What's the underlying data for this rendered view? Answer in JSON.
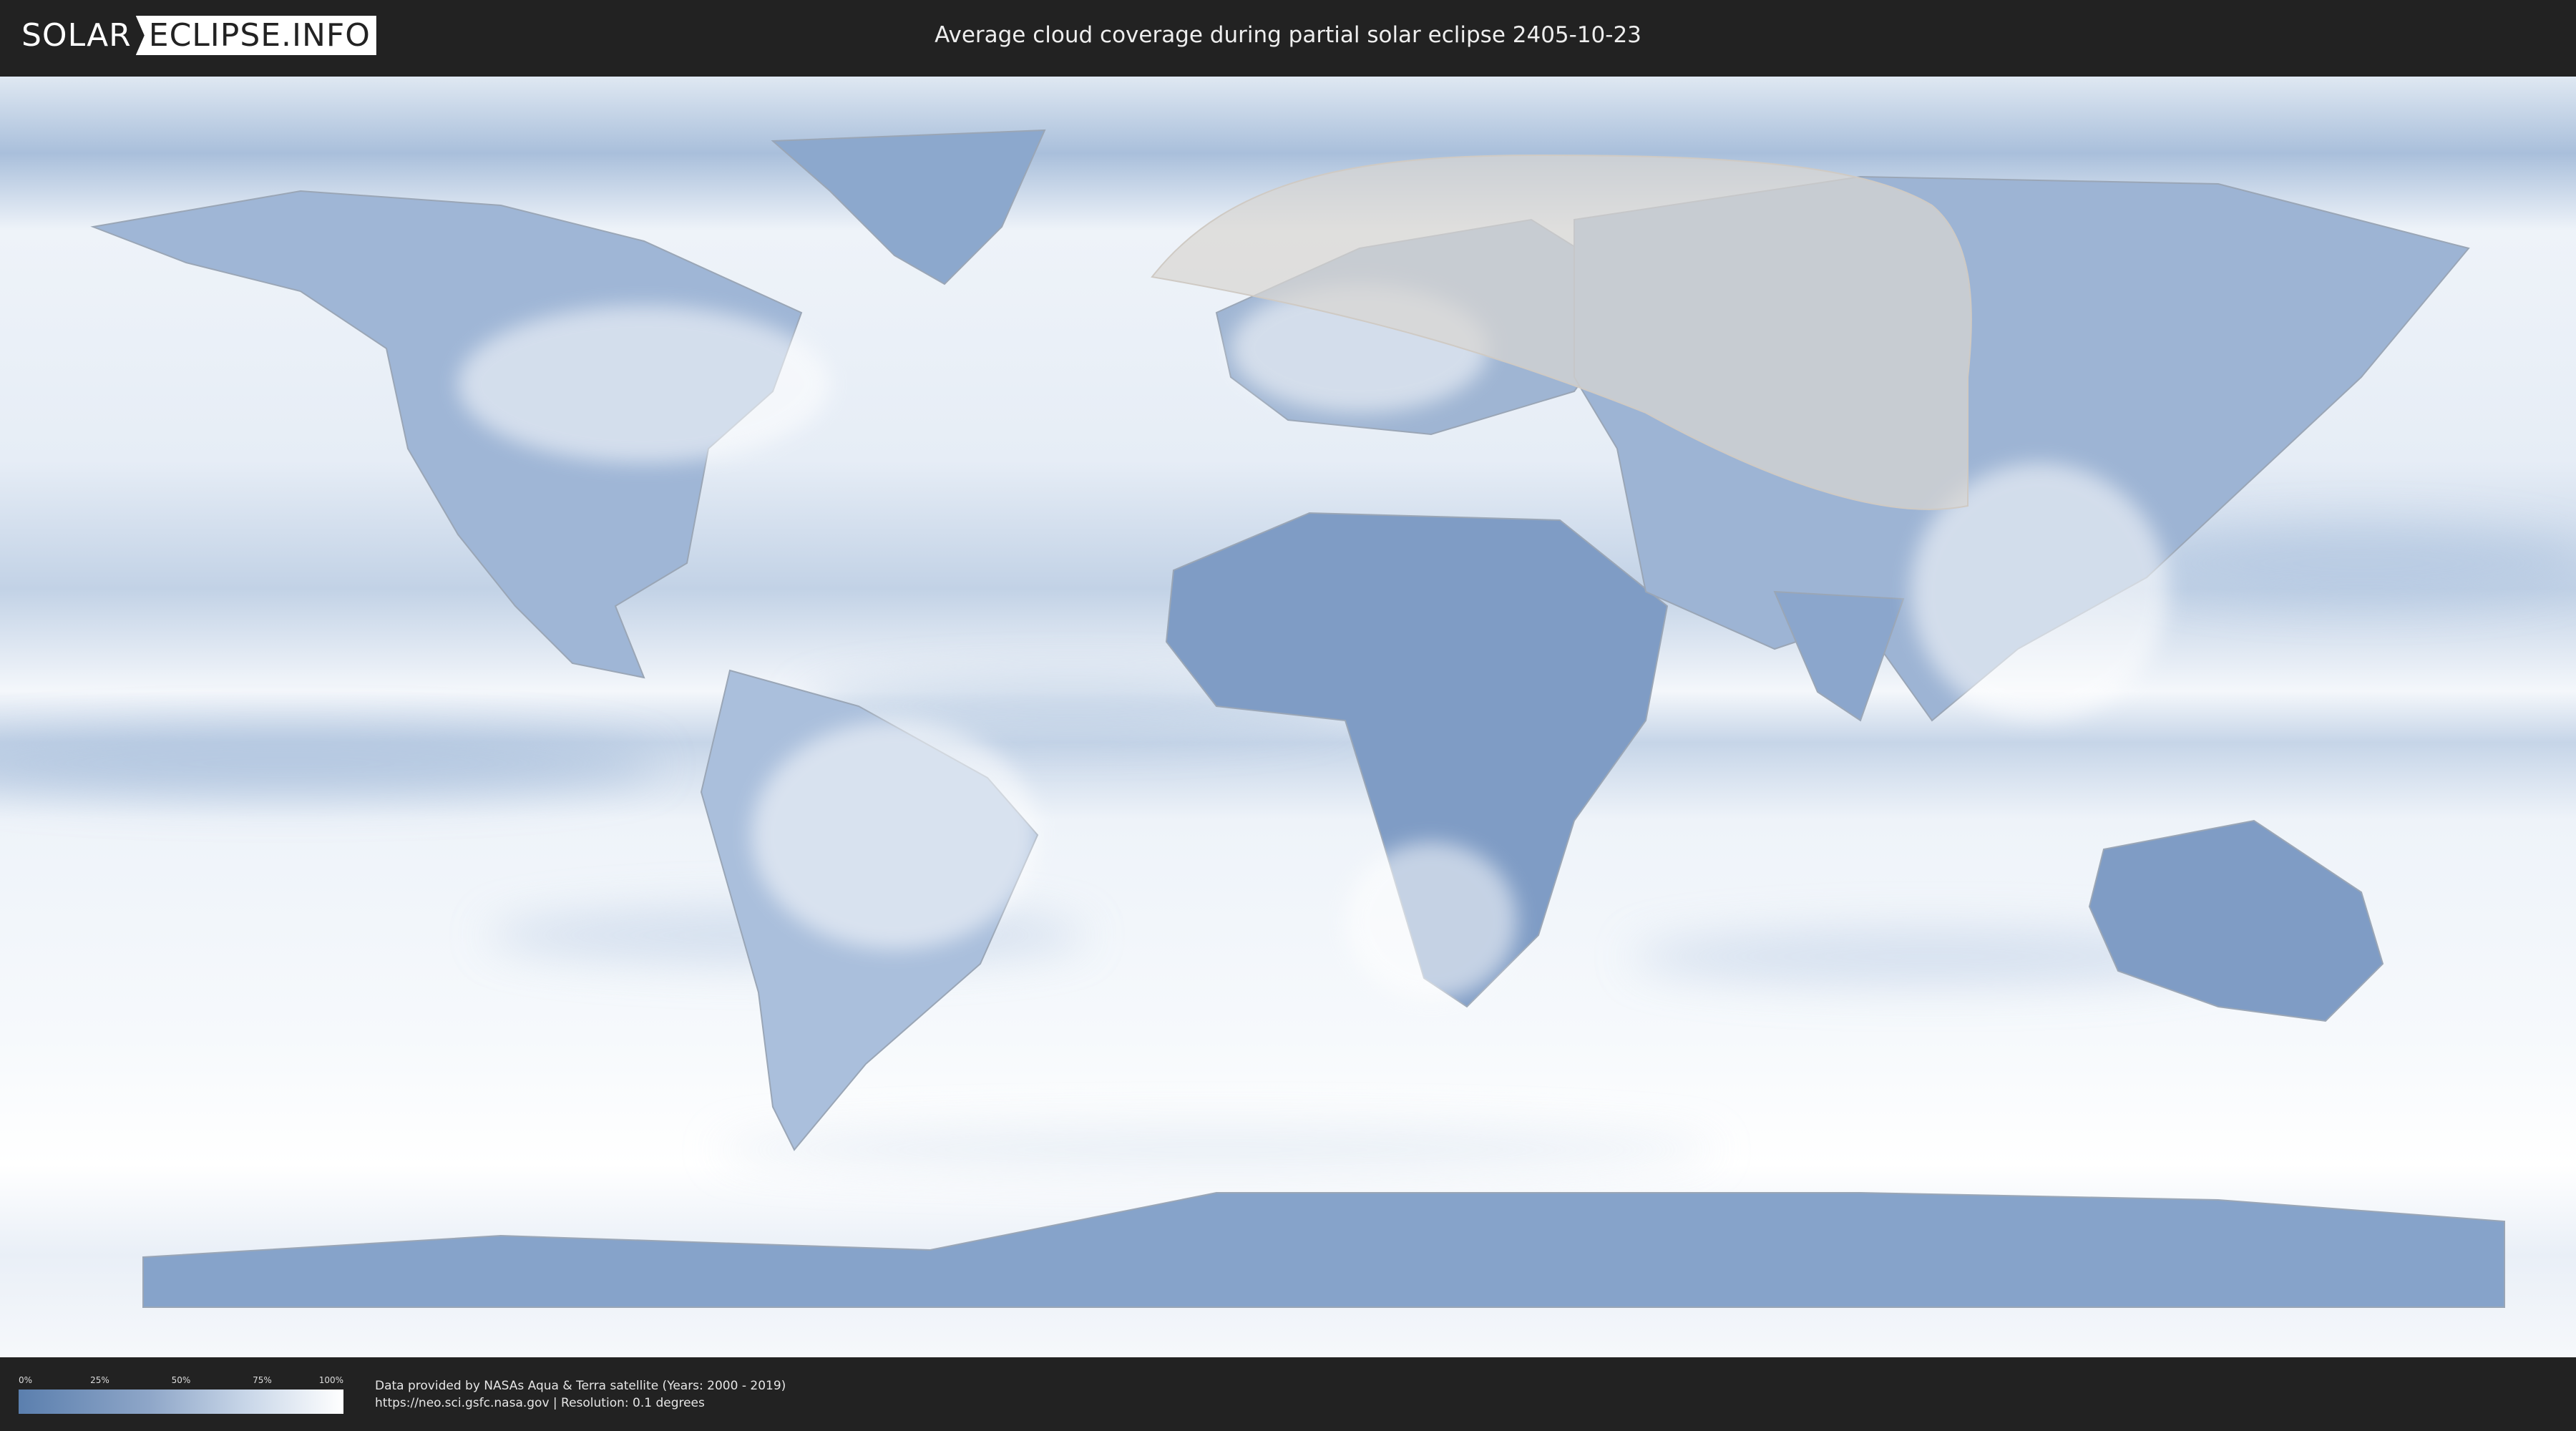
{
  "header": {
    "logo_left": "SOLAR",
    "logo_right": "ECLIPSE.INFO",
    "title": "Average cloud coverage during partial solar eclipse 2405-10-23"
  },
  "legend": {
    "ticks": [
      "0%",
      "25%",
      "50%",
      "75%",
      "100%"
    ],
    "colors": {
      "low": "#5b7fae",
      "high": "#ffffff"
    }
  },
  "credits": {
    "line1": "Data provided by NASAs Aqua & Terra satellite (Years: 2000 - 2019)",
    "line2": "https://neo.sci.gsfc.nasa.gov | Resolution: 0.1 degrees"
  },
  "map": {
    "colors": {
      "ocean_cloud": "#eef3f9",
      "clear_land": "#7f9cc5",
      "eclipse_zone": "#d9d6d2"
    }
  }
}
